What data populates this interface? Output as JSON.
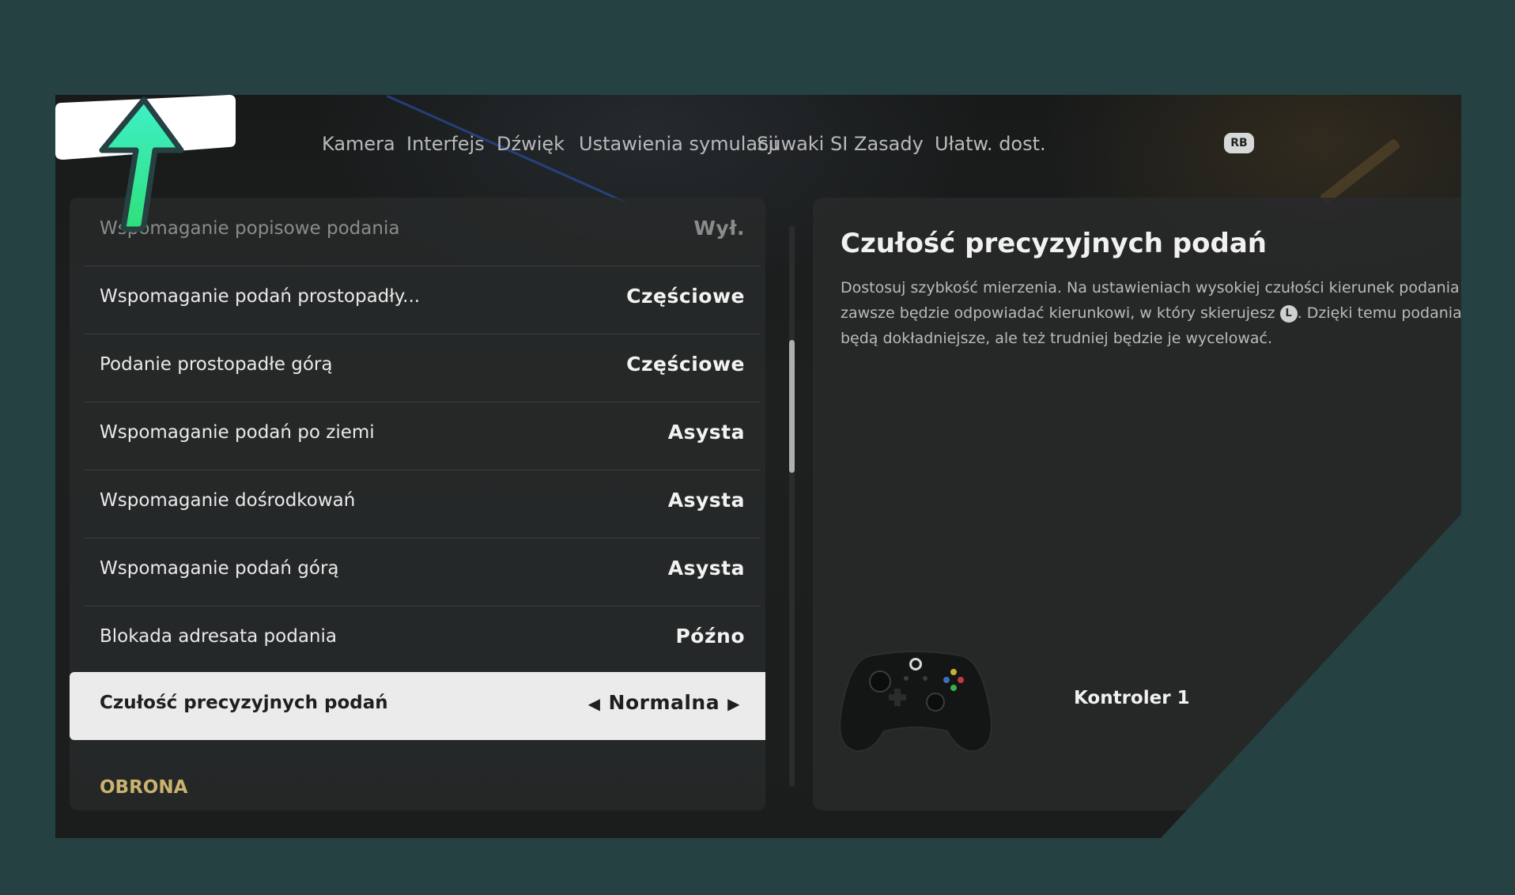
{
  "tabs": [
    {
      "label": "Kamera"
    },
    {
      "label": "Interfejs"
    },
    {
      "label": "Dźwięk"
    },
    {
      "label": "Ustawienia symulacji"
    },
    {
      "label": "Suwaki SI"
    },
    {
      "label": "Zasady"
    },
    {
      "label": "Ułatw. dost."
    }
  ],
  "tab_next_button": "RB",
  "settings": [
    {
      "label": "Wspomaganie popisowe podania",
      "value": "Wył."
    },
    {
      "label": "Wspomaganie podań prostopadły...",
      "value": "Częściowe"
    },
    {
      "label": "Podanie prostopadłe górą",
      "value": "Częściowe"
    },
    {
      "label": "Wspomaganie podań po ziemi",
      "value": "Asysta"
    },
    {
      "label": "Wspomaganie dośrodkowań",
      "value": "Asysta"
    },
    {
      "label": "Wspomaganie podań górą",
      "value": "Asysta"
    },
    {
      "label": "Blokada adresata podania",
      "value": "Późno"
    },
    {
      "label": "Czułość precyzyjnych podań",
      "value": "Normalna"
    }
  ],
  "section_next": "OBRONA",
  "detail": {
    "title": "Czułość precyzyjnych podań",
    "desc_part1": "Dostosuj szybkość mierzenia. Na ustawieniach wysokiej czułości kierunek podania zawsze będzie odpowiadać kierunkowi, w który skierujesz",
    "stick_glyph": "L",
    "desc_part2": ". Dzięki temu podania będą dokładniejsze, ale też trudniej będzie je wycelować."
  },
  "controller_label": "Kontroler 1",
  "colors": {
    "page_bg": "#254141",
    "section_header": "#c9b36e",
    "selected_row_bg": "#ebebeb",
    "logo_arrow_top": "#3ff0c8",
    "logo_arrow_bottom": "#2ee07a"
  },
  "icons": {
    "logo": "uptrend-logo-icon",
    "controller": "xbox-controller-icon",
    "left_arrow": "triangle-left-icon",
    "right_arrow": "triangle-right-icon"
  }
}
